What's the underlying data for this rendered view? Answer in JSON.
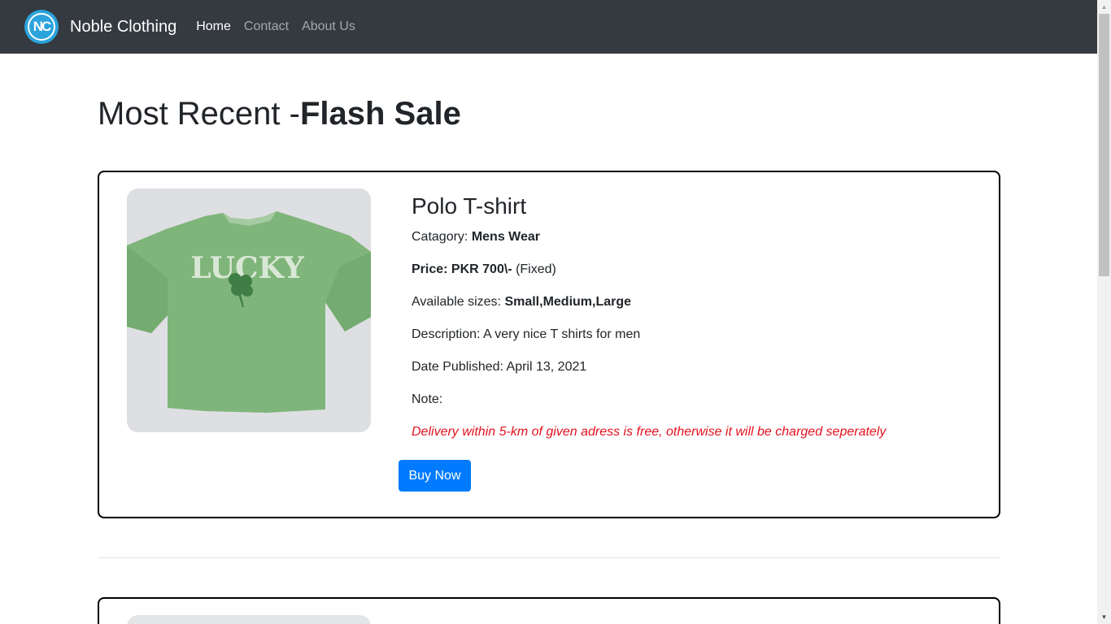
{
  "navbar": {
    "logo_text": "NC",
    "brand": "Noble Clothing",
    "links": [
      {
        "label": "Home",
        "active": true
      },
      {
        "label": "Contact",
        "active": false
      },
      {
        "label": "About Us",
        "active": false
      }
    ]
  },
  "page": {
    "title_prefix": "Most Recent -",
    "title_bold": "Flash Sale"
  },
  "product": {
    "image_text": "LUCKY",
    "title": "Polo T-shirt",
    "category_label": "Catagory: ",
    "category_value": "Mens Wear",
    "price_label": "Price: PKR 700\\- ",
    "price_note": "(Fixed)",
    "sizes_label": "Available sizes: ",
    "sizes_value": "Small,Medium,Large",
    "description": "Description: A very nice T shirts for men",
    "date_published": "Date Published: April 13, 2021",
    "note_label": "Note:",
    "note_text": "Delivery within 5-km of given adress is free, otherwise it will be charged seperately",
    "buy_label": "Buy Now"
  },
  "icons": {
    "scroll_up": "scroll-up-arrow-icon",
    "scroll_down": "scroll-down-arrow-icon",
    "shamrock": "shamrock-icon"
  },
  "colors": {
    "navbar_bg": "#343a40",
    "accent_blue": "#007bff",
    "note_red": "#e3121f",
    "shirt_green": "#7fb57a"
  }
}
